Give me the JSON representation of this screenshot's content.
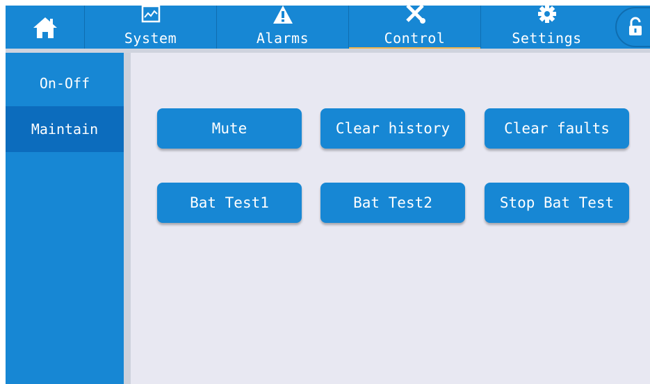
{
  "nav": {
    "home_icon": "home-icon",
    "tabs": [
      {
        "label": "System",
        "icon": "chart-icon"
      },
      {
        "label": "Alarms",
        "icon": "warning-icon"
      },
      {
        "label": "Control",
        "icon": "tools-icon",
        "active": true
      },
      {
        "label": "Settings",
        "icon": "gear-icon"
      }
    ],
    "lock_icon": "unlock-icon"
  },
  "sidebar": {
    "items": [
      {
        "label": "On-Off",
        "selected": false
      },
      {
        "label": "Maintain",
        "selected": true
      }
    ]
  },
  "actions": {
    "row1": [
      "Mute",
      "Clear history",
      "Clear faults"
    ],
    "row2": [
      "Bat Test1",
      "Bat Test2",
      "Stop Bat Test"
    ]
  },
  "colors": {
    "primary": "#1787d4",
    "selected": "#0c6cbd",
    "background": "#e8e8f2",
    "active_underline": "#f0b44a"
  }
}
